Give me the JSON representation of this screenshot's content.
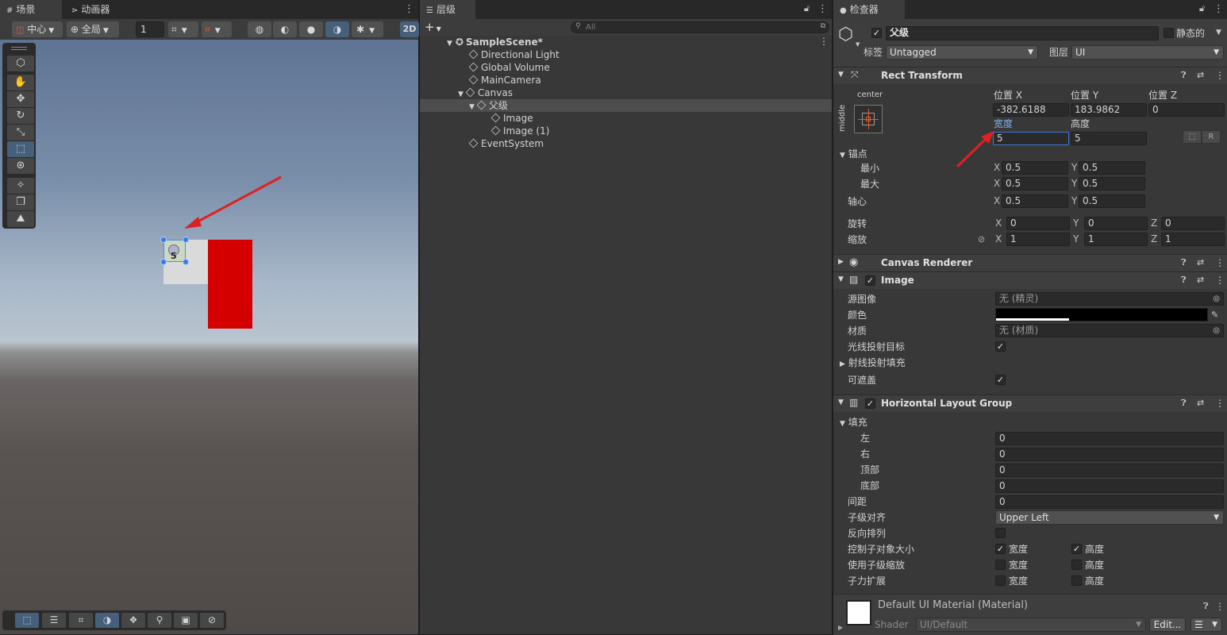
{
  "scene": {
    "tab_scene": "场景",
    "tab_animator": "动画器",
    "pivot_mode": "中心",
    "pivot_rotation": "全局",
    "grid_snap_value": "1",
    "mode_2d": "2D",
    "gizmo_label": "5"
  },
  "hierarchy": {
    "tab": "层级",
    "search_placeholder": "All",
    "add_label": "+",
    "items": [
      {
        "label": "SampleScene*"
      },
      {
        "label": "Directional Light"
      },
      {
        "label": "Global Volume"
      },
      {
        "label": "MainCamera"
      },
      {
        "label": "Canvas"
      },
      {
        "label": "父级"
      },
      {
        "label": "Image"
      },
      {
        "label": "Image (1)"
      },
      {
        "label": "EventSystem"
      }
    ]
  },
  "inspector": {
    "tab": "检查器",
    "object_name": "父级",
    "static_label": "静态的",
    "tag_label": "标签",
    "tag_value": "Untagged",
    "layer_label": "图层",
    "layer_value": "UI",
    "rect_transform": {
      "title": "Rect Transform",
      "anchor_h": "center",
      "anchor_v": "middle",
      "pos_x_label": "位置 X",
      "pos_y_label": "位置 Y",
      "pos_z_label": "位置 Z",
      "pos_x": "-382.6188",
      "pos_y": "183.9862",
      "pos_z": "0",
      "width_label": "宽度",
      "height_label": "高度",
      "width": "5",
      "height": "5",
      "r_button": "R",
      "anchors_label": "锚点",
      "min_label": "最小",
      "max_label": "最大",
      "pivot_label": "轴心",
      "x": "X",
      "y": "Y",
      "z": "Z",
      "min_x": "0.5",
      "min_y": "0.5",
      "max_x": "0.5",
      "max_y": "0.5",
      "pivot_x": "0.5",
      "pivot_y": "0.5",
      "rotation_label": "旋转",
      "scale_label": "缩放",
      "rot_x": "0",
      "rot_y": "0",
      "rot_z": "0",
      "scale_x": "1",
      "scale_y": "1",
      "scale_z": "1"
    },
    "canvas_renderer": {
      "title": "Canvas Renderer"
    },
    "image": {
      "title": "Image",
      "source_label": "源图像",
      "source_value": "无 (精灵)",
      "color_label": "颜色",
      "color_value": "#000000",
      "material_label": "材质",
      "material_value": "无 (材质)",
      "raycast_target_label": "光线投射目标",
      "raycast_padding_label": "射线投射填充",
      "maskable_label": "可遮盖"
    },
    "hlg": {
      "title": "Horizontal Layout Group",
      "padding_label": "填充",
      "left_label": "左",
      "right_label": "右",
      "top_label": "顶部",
      "bottom_label": "底部",
      "left": "0",
      "right": "0",
      "top": "0",
      "bottom": "0",
      "spacing_label": "间距",
      "spacing": "0",
      "child_alignment_label": "子级对齐",
      "child_alignment": "Upper Left",
      "reverse_label": "反向排列",
      "control_size_label": "控制子对象大小",
      "use_scale_label": "使用子级缩放",
      "force_expand_label": "子力扩展",
      "width": "宽度",
      "height": "高度"
    },
    "material": {
      "title": "Default UI Material (Material)",
      "shader_label": "Shader",
      "shader_value": "UI/Default",
      "edit_button": "Edit..."
    }
  }
}
